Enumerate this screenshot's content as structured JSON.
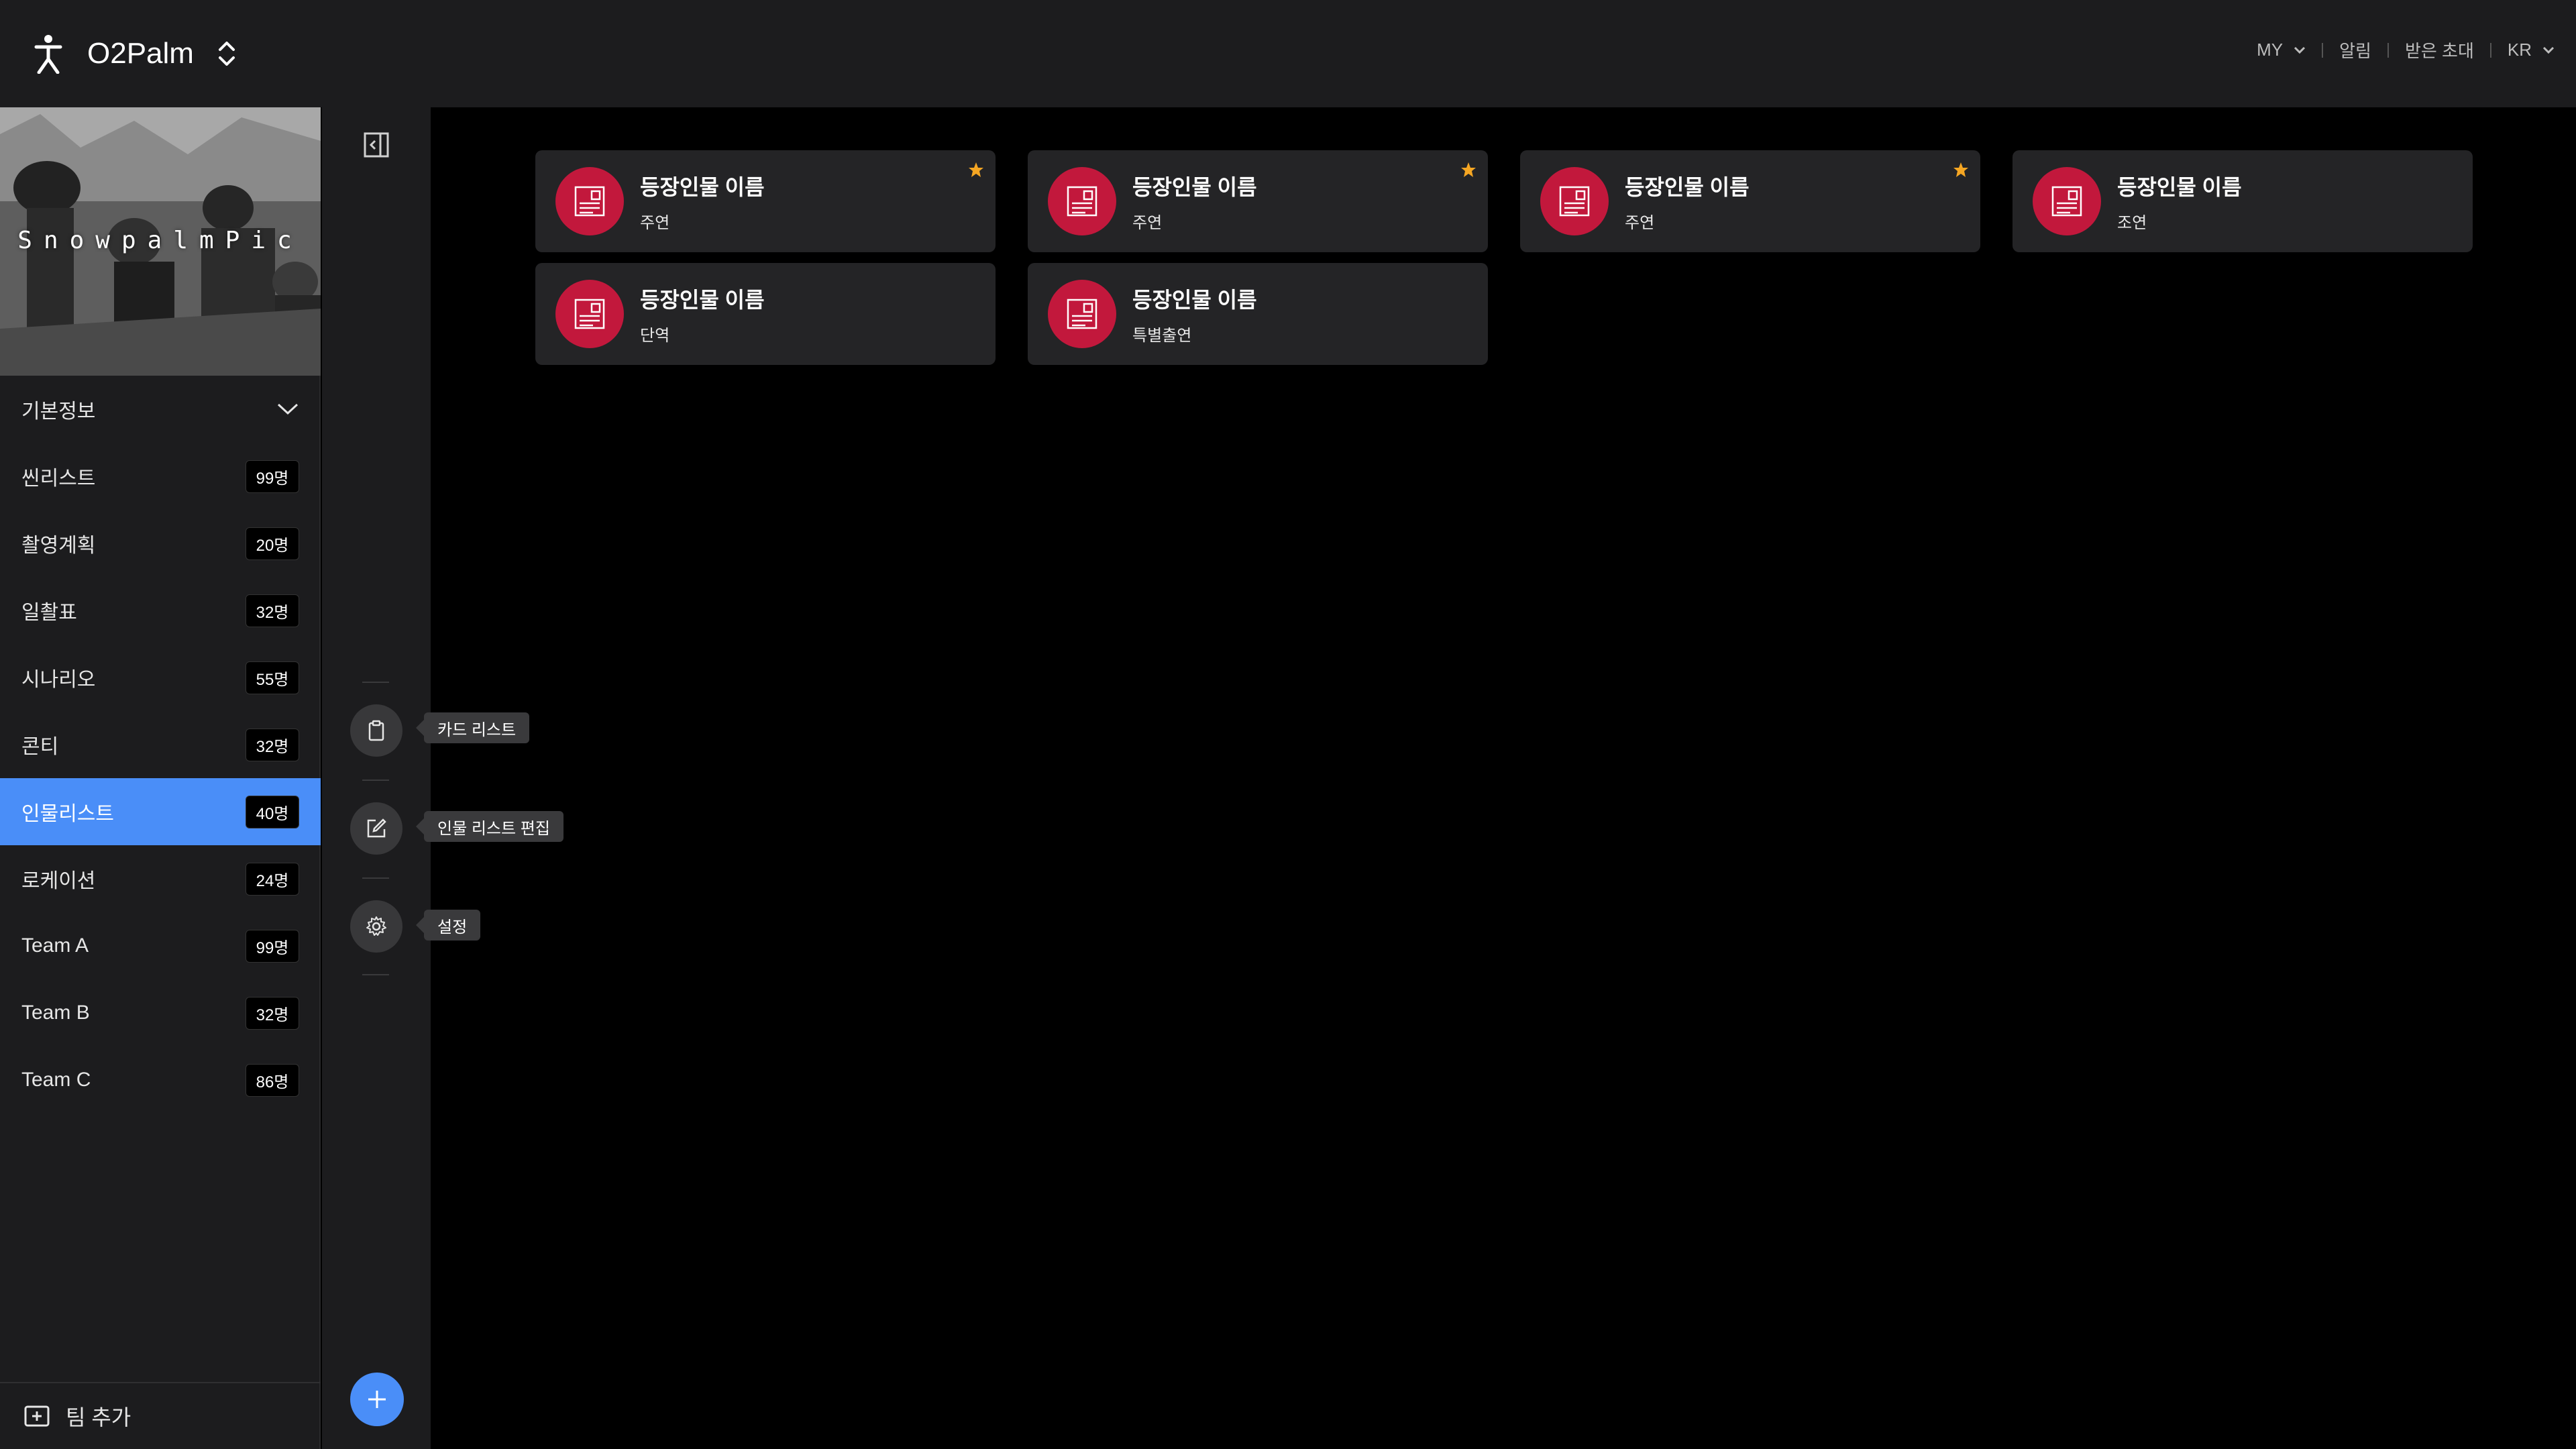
{
  "app": {
    "name": "O2Palm"
  },
  "header_links": [
    "MY",
    "알림",
    "받은 초대",
    "KR"
  ],
  "sidebar": {
    "banner_text": "SnowpalmPic",
    "section_label": "기본정보",
    "items": [
      {
        "label": "씬리스트",
        "count": "99명",
        "active": false
      },
      {
        "label": "촬영계획",
        "count": "20명",
        "active": false
      },
      {
        "label": "일촬표",
        "count": "32명",
        "active": false
      },
      {
        "label": "시나리오",
        "count": "55명",
        "active": false
      },
      {
        "label": "콘티",
        "count": "32명",
        "active": false
      },
      {
        "label": "인물리스트",
        "count": "40명",
        "active": true
      },
      {
        "label": "로케이션",
        "count": "24명",
        "active": false
      },
      {
        "label": "Team A",
        "count": "99명",
        "active": false
      },
      {
        "label": "Team B",
        "count": "32명",
        "active": false
      },
      {
        "label": "Team C",
        "count": "86명",
        "active": false
      }
    ],
    "add_team_label": "팀 추가"
  },
  "rail": {
    "tools": [
      {
        "icon": "clipboard-icon",
        "tooltip": "카드 리스트"
      },
      {
        "icon": "edit-icon",
        "tooltip": "인물 리스트 편집"
      },
      {
        "icon": "gear-icon",
        "tooltip": "설정"
      }
    ]
  },
  "cards": [
    {
      "name": "등장인물 이름",
      "role": "주연",
      "starred": true
    },
    {
      "name": "등장인물 이름",
      "role": "주연",
      "starred": true
    },
    {
      "name": "등장인물 이름",
      "role": "주연",
      "starred": true
    },
    {
      "name": "등장인물 이름",
      "role": "조연",
      "starred": false
    },
    {
      "name": "등장인물 이름",
      "role": "단역",
      "starred": false
    },
    {
      "name": "등장인물 이름",
      "role": "특별출연",
      "starred": false
    }
  ],
  "colors": {
    "accent": "#4a8ef8",
    "avatar": "#c2183c",
    "star": "#f5a623",
    "panel": "#1c1c1e",
    "card": "#242426"
  }
}
